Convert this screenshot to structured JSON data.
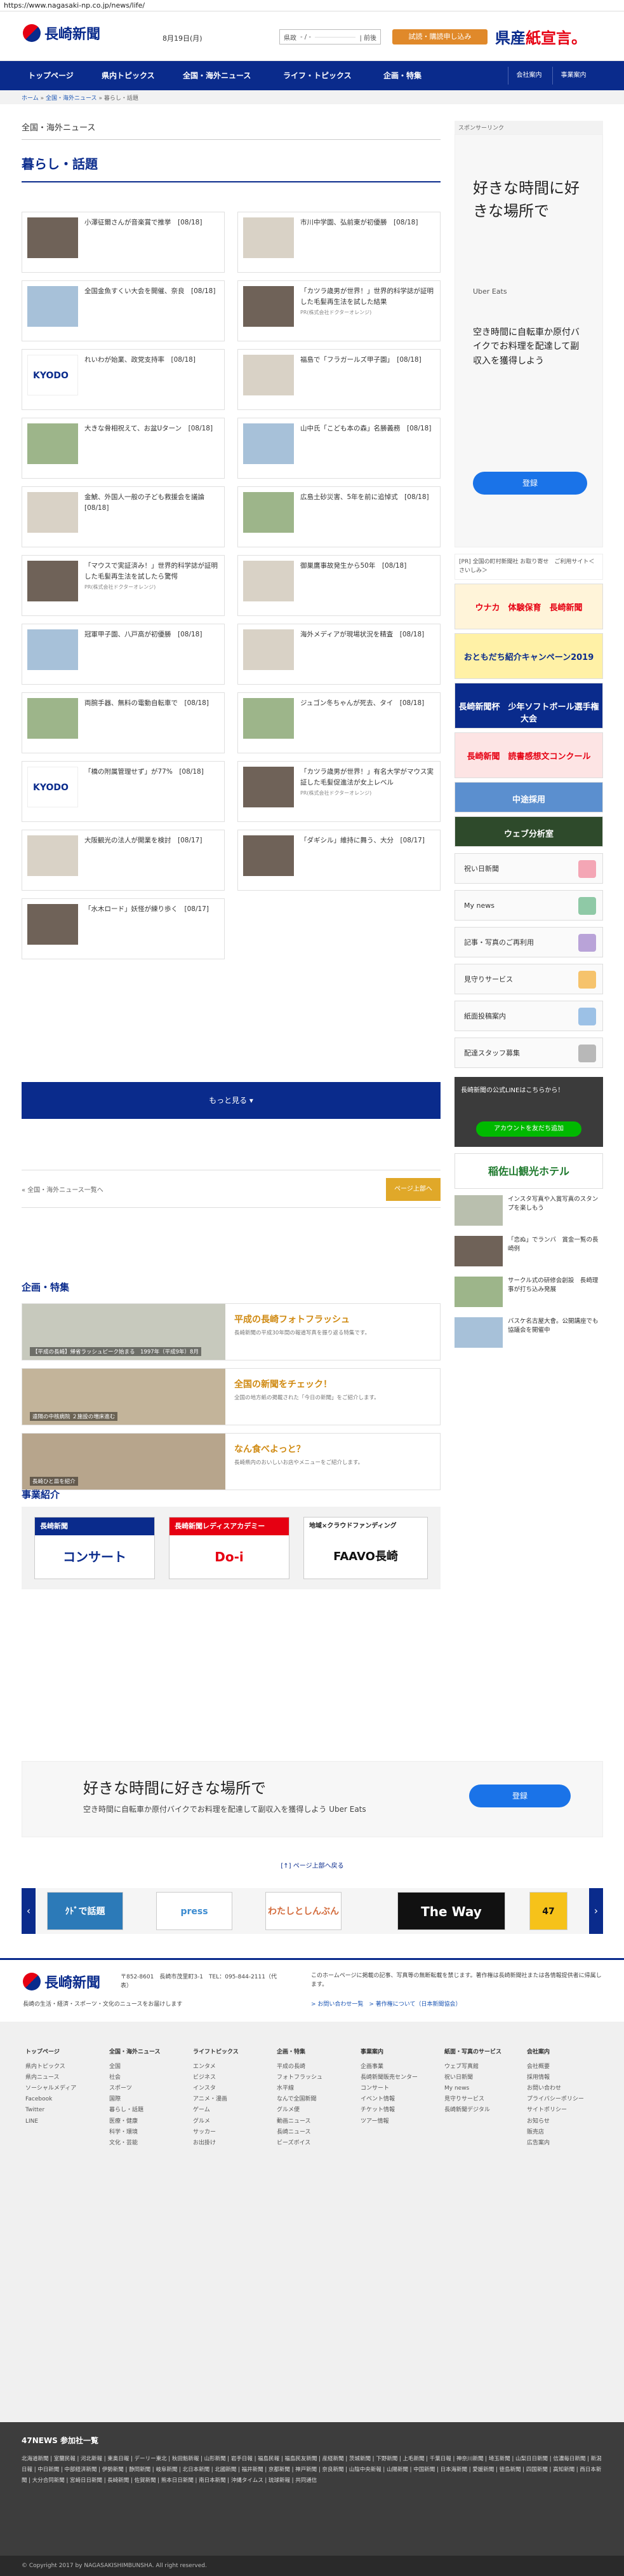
{
  "browser": {
    "url": "https://www.nagasaki-np.co.jp/news/life/"
  },
  "header": {
    "logo_text": "長崎新聞",
    "date": "8月19日(月)",
    "search_label": "県政",
    "search_date": "- / -",
    "search_btn": "| 前後",
    "trial_btn": "試読・購読申し込み",
    "paper_banner_left": "県産",
    "paper_banner_right": "紙宣言。"
  },
  "gnav": {
    "items": [
      "トップページ",
      "県内トピックス",
      "全国・海外ニュース",
      "ライフ・トピックス",
      "企画・特集"
    ],
    "right": [
      "会社案内",
      "事業案内"
    ]
  },
  "breadcrumb": {
    "home": "ホーム",
    "sep": "»",
    "cat": "全国・海外ニュース",
    "current": "暮らし・話題"
  },
  "main": {
    "section_head": "全国・海外ニュース",
    "category_title": "暮らし・話題",
    "articles": [
      {
        "text": "小澤征爾さんが音楽賞で推挙　[08/18]",
        "thumb": "dark"
      },
      {
        "text": "市川中学園、弘前東が初優勝　[08/18]",
        "thumb": "light"
      },
      {
        "text": "全国金魚すくい大会を開催、奈良　[08/18]",
        "thumb": "blue"
      },
      {
        "text": "「カツラ歳男が世界！」世界的科学誌が証明した毛髪再生法を試した結果",
        "thumb": "dark",
        "pr": "PR(株式会社ドクターオレンジ)"
      },
      {
        "text": "れいわが始業、政党支持率　[08/18]",
        "thumb": "kyodo"
      },
      {
        "text": "福島で「フラガールズ甲子園」　[08/18]",
        "thumb": "light"
      },
      {
        "text": "大きな骨相祝えて、お盆Uターン　[08/18]",
        "thumb": "green"
      },
      {
        "text": "山中氏「こども本の森」名勝義務　[08/18]",
        "thumb": "blue"
      },
      {
        "text": "金鯱、外国人一般の子ども救援会を議論　[08/18]",
        "thumb": "light"
      },
      {
        "text": "広島土砂災害、5年を前に追悼式　[08/18]",
        "thumb": "green"
      },
      {
        "text": "「マウスで実証済み！」世界的科学誌が証明した毛髪再生法を試したら驚愕",
        "thumb": "dark",
        "pr": "PR(株式会社ドクターオレンジ)"
      },
      {
        "text": "御巣鷹事故発生から50年　[08/18]",
        "thumb": "light"
      },
      {
        "text": "冠軍甲子園、八戸高が初優勝　[08/18]",
        "thumb": "blue"
      },
      {
        "text": "海外メディアが現場状況を精査　[08/18]",
        "thumb": "light"
      },
      {
        "text": "両腕手器、無料の電動自転車で　[08/18]",
        "thumb": "green"
      },
      {
        "text": "ジュゴン冬ちゃんが死去、タイ　[08/18]",
        "thumb": "green"
      },
      {
        "text": "「橋の附属管理せず」が77%　[08/18]",
        "thumb": "kyodo"
      },
      {
        "text": "「カツラ歳男が世界！」有名大学がマウス実証した毛髪促進法が女上レベル",
        "thumb": "dark",
        "pr": "PR(株式会社ドクターオレンジ)"
      },
      {
        "text": "大阪観光の法人が開業を検討　[08/17]",
        "thumb": "light"
      },
      {
        "text": "「ダギシル」維持に舞う、大分　[08/17]",
        "thumb": "dark"
      },
      {
        "text": "「水木ロード」妖怪が練り歩く　[08/17]",
        "thumb": "dark"
      }
    ],
    "more_btn": "もっと見る ▾",
    "pager_back": "« 全国・海外ニュース一覧へ",
    "pager_top": "ページ上部へ",
    "feature_title": "企画・特集",
    "features": [
      {
        "title": "平成の長崎フォトフラッシュ",
        "caption": "【平成の長崎】帰省ラッシュピーク始まる　1997年（平成9年）8月",
        "desc": "長崎新聞の平成30年間の報道写真を振り返る特集です。"
      },
      {
        "title": "全国の新聞をチェック！",
        "caption": "遠隔の中核病院 ２施設の増床進む",
        "desc": "全国の地方紙の掲載された「今日の新聞」をご紹介します。"
      },
      {
        "title": "なん食べよっと？",
        "caption": "長崎ひと皿を紹介",
        "desc": "長崎県内のおいしいお店やメニューをご紹介します。"
      }
    ],
    "business_title": "事業紹介",
    "business_cards": [
      {
        "top": "長崎新聞",
        "body": "コンサート"
      },
      {
        "top": "長崎新聞レディスアカデミー",
        "body": "Do-i"
      },
      {
        "top": "地域×クラウドファンディング",
        "body": "FAAVO長崎"
      }
    ]
  },
  "sidebar": {
    "sponsor_label": "スポンサーリンク",
    "ad": {
      "headline": "好きな時間に好きな場所で",
      "brand": "Uber Eats",
      "desc": "空き時間に自転車か原付バイクでお料理を配達して副収入を獲得しよう",
      "cta": "登録"
    },
    "pr_note": "[PR] 全国の町村新聞社 お取り寄せ　ご利用サイト＜さいしみ＞",
    "banners": [
      "ウナカ　体験保育　長崎新聞",
      "おともだち紹介キャンペーン2019",
      "長崎新聞杯　少年ソフトボール選手権大会",
      "長崎新聞　読書感想文コンクール",
      "中途採用",
      "ウェブ分析室"
    ],
    "buttons": [
      "祝い日新聞",
      "My news",
      "記事・写真のご再利用",
      "見守りサービス",
      "紙面投稿案内",
      "配達スタッフ募集"
    ],
    "line_text": "長崎新聞の公式LINEはこちらから！",
    "line_btn": "アカウントを友だち追加",
    "hotel": "稲佐山観光ホテル",
    "side_list": [
      "インスタ写真や入賞写真のスタンプを楽しもう",
      "「恋ぬ」でランバ　賞金一覧の長崎例",
      "サークル式の研修会創設　長崎理事が打ち込み発展",
      "バスケ名古屋大會。公開講座でも協議会を開催中"
    ]
  },
  "bottom_ad": {
    "headline": "好きな時間に好きな場所で",
    "desc": "空き時間に自転車か原付バイクでお料理を配達して副収入を獲得しよう Uber Eats",
    "cta": "登録"
  },
  "page_top": "[↑] ページ上部へ戻る",
  "banner_row": [
    "ｸﾄﾞで話題",
    "press",
    "わたしとしんぶん",
    "The Way",
    "47"
  ],
  "footer": {
    "logo_text": "長崎新聞",
    "address": "〒852-8601　長崎市茂里町3-1　TEL：095-844-2111（代表）",
    "tagline": "長崎の生活・経済・スポーツ・文化のニュースをお届けします",
    "notice": "このホームページに掲載の記事、写真等の無断転載を禁じます。著作権は長崎新聞社または各情報提供者に帰属します。",
    "links": "> お問い合わせ一覧　> 著作権について（日本新聞協会）"
  },
  "sitemap": [
    {
      "h": "トップページ",
      "items": [
        "県内トピックス",
        "県内ニュース",
        "ソーシャルメディア",
        "Facebook",
        "Twitter",
        "LINE"
      ]
    },
    {
      "h": "全国・海外ニュース",
      "items": [
        "全国",
        "社会",
        "スポーツ",
        "国際",
        "暮らし・話題",
        "医療・健康",
        "科学・環境",
        "文化・芸能"
      ]
    },
    {
      "h": "ライフトピックス",
      "items": [
        "エンタメ",
        "ビジネス",
        "インスタ",
        "アニメ・漫画",
        "ゲーム",
        "グルメ",
        "サッカー",
        "お出掛け"
      ]
    },
    {
      "h": "企画・特集",
      "items": [
        "平成の長崎",
        "フォトフラッシュ",
        "水平線",
        "なんで全国新聞",
        "グルメ便",
        "動画ニュース",
        "長崎ニュース",
        "ビーズボイス"
      ]
    },
    {
      "h": "事業案内",
      "items": [
        "企画事業",
        "長崎新聞販売センター",
        "コンサート",
        "イベント情報",
        "チケット情報",
        "ツアー情報"
      ]
    },
    {
      "h": "紙面・写真のサービス",
      "items": [
        "ウェブ写真館",
        "祝い日新聞",
        "My news",
        "見守りサービス",
        "長崎新聞デジタル"
      ]
    },
    {
      "h": "会社案内",
      "items": [
        "会社概要",
        "採用情報",
        "お問い合わせ",
        "プライバシーポリシー",
        "サイトポリシー",
        "お知らせ",
        "販売店",
        "広告案内"
      ]
    }
  ],
  "news47": {
    "heading": "47NEWS 参加社一覧",
    "list": "北海道新聞 | 室蘭民報 | 河北新報 | 東奥日報 | デーリー東北 | 秋田魁新報 | 山形新聞 | 岩手日報 | 福島民報 | 福島民友新聞 | 産経新聞 | 茨城新聞 | 下野新聞 | 上毛新聞 | 千葉日報 | 神奈川新聞 | 埼玉新聞 | 山梨日日新聞 | 信濃毎日新聞 | 新潟日報 | 中日新聞 | 中部経済新聞 | 伊勢新聞 | 静岡新聞 | 岐阜新聞 | 北日本新聞 | 北國新聞 | 福井新聞 | 京都新聞 | 神戸新聞 | 奈良新聞 | 山陰中央新報 | 山陽新聞 | 中国新聞 | 日本海新聞 | 愛媛新聞 | 徳島新聞 | 四国新聞 | 高知新聞 | 西日本新聞 | 大分合同新聞 | 宮崎日日新聞 | 長崎新聞 | 佐賀新聞 | 熊本日日新聞 | 南日本新聞 | 沖縄タイムス | 琉球新報 | 共同通信"
  },
  "copyright": "© Copyright 2017 by NAGASAKISHIMBUNSHA. All right reserved."
}
